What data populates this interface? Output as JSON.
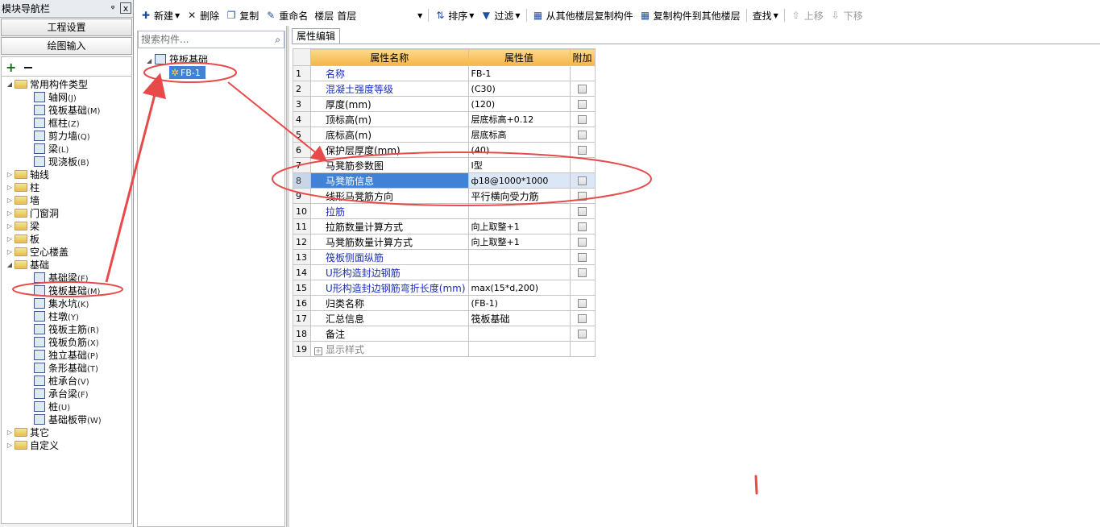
{
  "nav": {
    "title": "模块导航栏",
    "pin": "ᵠ",
    "close": "x",
    "section1": "工程设置",
    "section2": "绘图输入",
    "add_tool": "+",
    "remove_tool": "−",
    "tree": {
      "common": {
        "label": "常用构件类型",
        "items": [
          {
            "label": "轴网",
            "key": "(J)"
          },
          {
            "label": "筏板基础",
            "key": "(M)"
          },
          {
            "label": "框柱",
            "key": "(Z)"
          },
          {
            "label": "剪力墙",
            "key": "(Q)"
          },
          {
            "label": "梁",
            "key": "(L)"
          },
          {
            "label": "现浇板",
            "key": "(B)"
          }
        ]
      },
      "groups1": [
        "轴线",
        "柱",
        "墙",
        "门窗洞",
        "梁",
        "板",
        "空心楼盖"
      ],
      "foundation": {
        "label": "基础",
        "items": [
          {
            "label": "基础梁",
            "key": "(F)"
          },
          {
            "label": "筏板基础",
            "key": "(M)"
          },
          {
            "label": "集水坑",
            "key": "(K)"
          },
          {
            "label": "柱墩",
            "key": "(Y)"
          },
          {
            "label": "筏板主筋",
            "key": "(R)"
          },
          {
            "label": "筏板负筋",
            "key": "(X)"
          },
          {
            "label": "独立基础",
            "key": "(P)"
          },
          {
            "label": "条形基础",
            "key": "(T)"
          },
          {
            "label": "桩承台",
            "key": "(V)"
          },
          {
            "label": "承台梁",
            "key": "(F)"
          },
          {
            "label": "桩",
            "key": "(U)"
          },
          {
            "label": "基础板带",
            "key": "(W)"
          }
        ]
      },
      "groups2": [
        "其它",
        "自定义"
      ]
    }
  },
  "toolbar": {
    "new": "新建",
    "delete": "删除",
    "copy": "复制",
    "rename": "重命名",
    "floor_label": "楼层",
    "floor_value": "首层",
    "sort": "排序",
    "filter": "过滤",
    "copy_from": "从其他楼层复制构件",
    "copy_to": "复制构件到其他楼层",
    "find": "查找",
    "move_up": "上移",
    "move_down": "下移"
  },
  "components": {
    "search_placeholder": "搜索构件...",
    "root": "筏板基础",
    "child": "FB-1"
  },
  "props": {
    "tab": "属性编辑",
    "col_name": "属性名称",
    "col_value": "属性值",
    "col_extra": "附加",
    "rows": [
      {
        "n": "1",
        "name": "名称",
        "value": "FB-1"
      },
      {
        "n": "2",
        "name": "混凝土强度等级",
        "value": "(C30)"
      },
      {
        "n": "3",
        "name": "厚度(mm)",
        "value": "(120)"
      },
      {
        "n": "4",
        "name": "顶标高(m)",
        "value": "层底标高+0.12"
      },
      {
        "n": "5",
        "name": "底标高(m)",
        "value": "层底标高"
      },
      {
        "n": "6",
        "name": "保护层厚度(mm)",
        "value": "(40)"
      },
      {
        "n": "7",
        "name": "马凳筋参数图",
        "value": "Ⅰ型"
      },
      {
        "n": "8",
        "name": "马凳筋信息",
        "value": "ф18@1000*1000"
      },
      {
        "n": "9",
        "name": "线形马凳筋方向",
        "value": "平行横向受力筋"
      },
      {
        "n": "10",
        "name": "拉筋",
        "value": ""
      },
      {
        "n": "11",
        "name": "拉筋数量计算方式",
        "value": "向上取整+1"
      },
      {
        "n": "12",
        "name": "马凳筋数量计算方式",
        "value": "向上取整+1"
      },
      {
        "n": "13",
        "name": "筏板侧面纵筋",
        "value": ""
      },
      {
        "n": "14",
        "name": "U形构造封边钢筋",
        "value": ""
      },
      {
        "n": "15",
        "name": "U形构造封边钢筋弯折长度(mm)",
        "value": "max(15*d,200)"
      },
      {
        "n": "16",
        "name": "归类名称",
        "value": "(FB-1)"
      },
      {
        "n": "17",
        "name": "汇总信息",
        "value": "筏板基础"
      },
      {
        "n": "18",
        "name": "备注",
        "value": ""
      },
      {
        "n": "19",
        "name": "显示样式",
        "value": ""
      }
    ]
  },
  "colors": {
    "annotation": "#e84a4a",
    "selection": "#3f82d6",
    "header": "#f5b54a",
    "link": "#1a2fbf"
  }
}
